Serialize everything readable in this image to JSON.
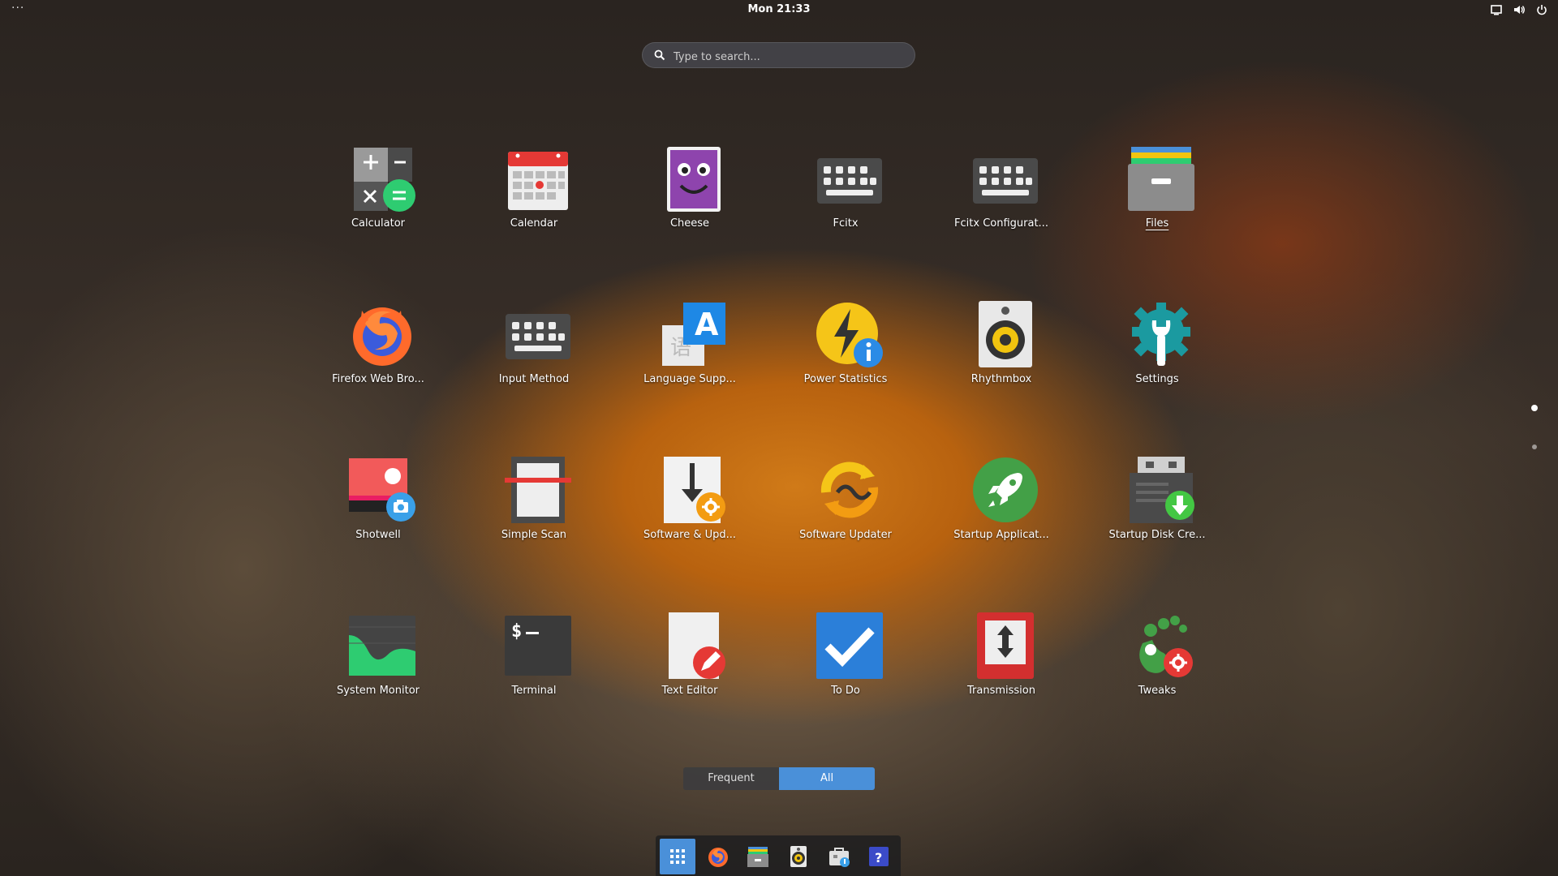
{
  "topbar": {
    "activities": "···",
    "clock": "Mon 21:33",
    "tray_icons": [
      "screen-icon",
      "volume-icon",
      "power-icon"
    ]
  },
  "search": {
    "placeholder": "Type to search..."
  },
  "apps": [
    {
      "label": "Calculator",
      "icon": "calculator-icon"
    },
    {
      "label": "Calendar",
      "icon": "calendar-icon"
    },
    {
      "label": "Cheese",
      "icon": "cheese-icon"
    },
    {
      "label": "Fcitx",
      "icon": "keyboard-icon"
    },
    {
      "label": "Fcitx Configurat...",
      "icon": "keyboard-icon"
    },
    {
      "label": "Files",
      "icon": "files-icon",
      "running": true
    },
    {
      "label": "Firefox Web Bro...",
      "icon": "firefox-icon"
    },
    {
      "label": "Input Method",
      "icon": "keyboard-icon"
    },
    {
      "label": "Language Supp...",
      "icon": "language-icon"
    },
    {
      "label": "Power Statistics",
      "icon": "power-statistics-icon"
    },
    {
      "label": "Rhythmbox",
      "icon": "rhythmbox-icon"
    },
    {
      "label": "Settings",
      "icon": "settings-icon"
    },
    {
      "label": "Shotwell",
      "icon": "shotwell-icon"
    },
    {
      "label": "Simple Scan",
      "icon": "scanner-icon"
    },
    {
      "label": "Software & Upd...",
      "icon": "software-properties-icon"
    },
    {
      "label": "Software Updater",
      "icon": "software-updater-icon"
    },
    {
      "label": "Startup Applicat...",
      "icon": "rocket-icon"
    },
    {
      "label": "Startup Disk Cre...",
      "icon": "usb-creator-icon"
    },
    {
      "label": "System Monitor",
      "icon": "system-monitor-icon"
    },
    {
      "label": "Terminal",
      "icon": "terminal-icon"
    },
    {
      "label": "Text Editor",
      "icon": "text-editor-icon"
    },
    {
      "label": "To Do",
      "icon": "todo-icon"
    },
    {
      "label": "Transmission",
      "icon": "transmission-icon"
    },
    {
      "label": "Tweaks",
      "icon": "tweaks-icon"
    }
  ],
  "view_toggle": {
    "frequent": "Frequent",
    "all": "All",
    "selected": "All"
  },
  "dock": [
    "show-apps-icon",
    "firefox-icon",
    "files-icon",
    "rhythmbox-icon",
    "software-icon",
    "help-icon"
  ],
  "colors": {
    "accent": "#4a90d9"
  }
}
